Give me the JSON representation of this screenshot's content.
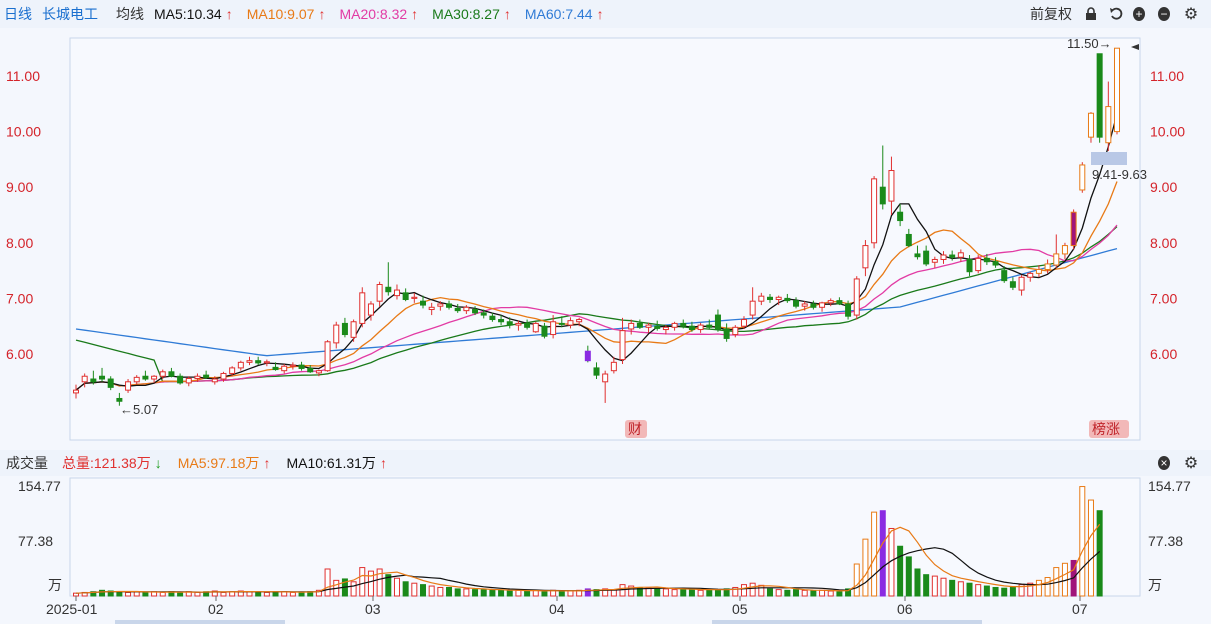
{
  "toolbar": {
    "period": "日线",
    "stock_name": "长城电工",
    "avg_label": "均线",
    "ma5": {
      "label": "MA5:10.34",
      "arrow": "↑",
      "color": "#111111"
    },
    "ma10": {
      "label": "MA10:9.07",
      "arrow": "↑",
      "color": "#e87a16"
    },
    "ma20": {
      "label": "MA20:8.32",
      "arrow": "↑",
      "color": "#e23ba4"
    },
    "ma30": {
      "label": "MA30:8.27",
      "arrow": "↑",
      "color": "#1a7a1a"
    },
    "ma60": {
      "label": "MA60:7.44",
      "arrow": "↑",
      "color": "#2f7bd6"
    },
    "adjust_label": "前复权",
    "icons": [
      "lock-icon",
      "undo-icon",
      "zoom-in-icon",
      "zoom-out-icon",
      "gear-icon"
    ]
  },
  "volume_bar": {
    "title": "成交量",
    "total": {
      "label": "总量:121.38万",
      "arrow": "↓",
      "color": "#e0302f"
    },
    "ma5": {
      "label": "MA5:97.18万",
      "arrow": "↑",
      "color": "#e87a16"
    },
    "ma10": {
      "label": "MA10:61.31万",
      "arrow": "↑",
      "color": "#111111"
    },
    "icons": [
      "close-icon",
      "gear-icon"
    ]
  },
  "chart_data": [
    {
      "type": "candlestick",
      "title": "长城电工 日线",
      "y_ticks": [
        "11.00",
        "10.00",
        "9.00",
        "8.00",
        "7.00",
        "6.00"
      ],
      "ylim": [
        4.6,
        11.9
      ],
      "annotations": {
        "high": "11.50→",
        "low": "←5.07",
        "range": "9.41-9.63"
      },
      "markers": [
        "财",
        "榜涨"
      ],
      "series": [
        {
          "name": "MA5",
          "color": "#111111"
        },
        {
          "name": "MA10",
          "color": "#e87a16"
        },
        {
          "name": "MA20",
          "color": "#e23ba4"
        },
        {
          "name": "MA30",
          "color": "#1a7a1a"
        },
        {
          "name": "MA60",
          "color": "#2f7bd6"
        }
      ],
      "candles": [
        [
          5.3,
          5.45,
          5.2,
          5.35
        ],
        [
          5.5,
          5.65,
          5.4,
          5.6
        ],
        [
          5.55,
          5.7,
          5.45,
          5.5
        ],
        [
          5.6,
          5.75,
          5.5,
          5.55
        ],
        [
          5.55,
          5.6,
          5.35,
          5.4
        ],
        [
          5.2,
          5.3,
          5.07,
          5.15
        ],
        [
          5.35,
          5.55,
          5.3,
          5.5
        ],
        [
          5.5,
          5.62,
          5.45,
          5.58
        ],
        [
          5.6,
          5.7,
          5.52,
          5.55
        ],
        [
          5.55,
          5.62,
          5.48,
          5.6
        ],
        [
          5.6,
          5.72,
          5.55,
          5.68
        ],
        [
          5.68,
          5.75,
          5.58,
          5.6
        ],
        [
          5.6,
          5.65,
          5.45,
          5.48
        ],
        [
          5.48,
          5.6,
          5.42,
          5.56
        ],
        [
          5.56,
          5.65,
          5.5,
          5.6
        ],
        [
          5.62,
          5.7,
          5.55,
          5.58
        ],
        [
          5.5,
          5.6,
          5.45,
          5.55
        ],
        [
          5.55,
          5.68,
          5.5,
          5.65
        ],
        [
          5.65,
          5.78,
          5.6,
          5.75
        ],
        [
          5.75,
          5.88,
          5.7,
          5.85
        ],
        [
          5.85,
          5.95,
          5.8,
          5.88
        ],
        [
          5.88,
          5.95,
          5.8,
          5.84
        ],
        [
          5.84,
          5.9,
          5.78,
          5.86
        ],
        [
          5.76,
          5.85,
          5.7,
          5.72
        ],
        [
          5.7,
          5.82,
          5.65,
          5.78
        ],
        [
          5.78,
          5.85,
          5.72,
          5.8
        ],
        [
          5.8,
          5.86,
          5.7,
          5.74
        ],
        [
          5.74,
          5.8,
          5.66,
          5.68
        ],
        [
          5.66,
          5.72,
          5.6,
          5.7
        ],
        [
          5.7,
          6.25,
          5.68,
          6.22
        ],
        [
          6.2,
          6.58,
          6.1,
          6.52
        ],
        [
          6.55,
          6.65,
          6.3,
          6.35
        ],
        [
          6.3,
          6.62,
          6.22,
          6.58
        ],
        [
          6.55,
          7.2,
          6.48,
          7.1
        ],
        [
          6.7,
          6.95,
          6.6,
          6.9
        ],
        [
          6.95,
          7.3,
          6.85,
          7.25
        ],
        [
          7.2,
          7.65,
          7.05,
          7.12
        ],
        [
          7.05,
          7.25,
          6.98,
          7.15
        ],
        [
          7.1,
          7.18,
          6.95,
          6.98
        ],
        [
          7.0,
          7.1,
          6.92,
          7.02
        ],
        [
          6.95,
          7.05,
          6.82,
          6.88
        ],
        [
          6.8,
          6.92,
          6.7,
          6.84
        ],
        [
          6.86,
          6.95,
          6.78,
          6.9
        ],
        [
          6.9,
          6.96,
          6.8,
          6.84
        ],
        [
          6.82,
          6.9,
          6.74,
          6.78
        ],
        [
          6.78,
          6.88,
          6.72,
          6.84
        ],
        [
          6.8,
          6.86,
          6.7,
          6.74
        ],
        [
          6.74,
          6.8,
          6.64,
          6.7
        ],
        [
          6.68,
          6.74,
          6.58,
          6.62
        ],
        [
          6.62,
          6.7,
          6.52,
          6.58
        ],
        [
          6.58,
          6.66,
          6.46,
          6.52
        ],
        [
          6.52,
          6.6,
          6.42,
          6.55
        ],
        [
          6.55,
          6.62,
          6.44,
          6.48
        ],
        [
          6.4,
          6.58,
          6.38,
          6.55
        ],
        [
          6.5,
          6.56,
          6.28,
          6.32
        ],
        [
          6.35,
          6.7,
          6.28,
          6.58
        ],
        [
          6.55,
          6.68,
          6.48,
          6.54
        ],
        [
          6.52,
          6.66,
          6.46,
          6.6
        ],
        [
          6.58,
          6.65,
          6.5,
          6.62
        ],
        [
          6.05,
          6.15,
          5.85,
          5.88
        ],
        [
          5.75,
          5.85,
          5.55,
          5.62
        ],
        [
          5.5,
          5.7,
          5.12,
          5.64
        ],
        [
          5.7,
          5.95,
          5.65,
          5.85
        ],
        [
          5.9,
          6.65,
          5.82,
          6.42
        ],
        [
          6.45,
          6.62,
          6.35,
          6.55
        ],
        [
          6.55,
          6.62,
          6.45,
          6.48
        ],
        [
          6.48,
          6.56,
          6.38,
          6.52
        ],
        [
          6.5,
          6.6,
          6.42,
          6.46
        ],
        [
          6.44,
          6.52,
          6.35,
          6.48
        ],
        [
          6.48,
          6.58,
          6.42,
          6.55
        ],
        [
          6.55,
          6.62,
          6.46,
          6.5
        ],
        [
          6.5,
          6.58,
          6.4,
          6.44
        ],
        [
          6.44,
          6.56,
          6.38,
          6.52
        ],
        [
          6.52,
          6.62,
          6.45,
          6.48
        ],
        [
          6.7,
          6.8,
          6.4,
          6.45
        ],
        [
          6.45,
          6.55,
          6.22,
          6.28
        ],
        [
          6.35,
          6.52,
          6.3,
          6.48
        ],
        [
          6.5,
          6.68,
          6.45,
          6.62
        ],
        [
          6.7,
          7.2,
          6.62,
          6.95
        ],
        [
          6.95,
          7.1,
          6.88,
          7.04
        ],
        [
          7.02,
          7.08,
          6.92,
          6.98
        ],
        [
          6.98,
          7.05,
          6.88,
          7.02
        ],
        [
          7.0,
          7.08,
          6.92,
          6.96
        ],
        [
          6.96,
          7.02,
          6.82,
          6.86
        ],
        [
          6.86,
          6.95,
          6.78,
          6.9
        ],
        [
          6.9,
          6.96,
          6.8,
          6.84
        ],
        [
          6.84,
          6.94,
          6.76,
          6.92
        ],
        [
          6.92,
          7.0,
          6.86,
          6.96
        ],
        [
          6.96,
          7.02,
          6.88,
          6.9
        ],
        [
          6.9,
          6.96,
          6.62,
          6.68
        ],
        [
          6.7,
          7.4,
          6.62,
          7.35
        ],
        [
          7.55,
          8.05,
          7.4,
          7.95
        ],
        [
          8.0,
          9.2,
          7.9,
          9.15
        ],
        [
          9.0,
          9.75,
          8.6,
          8.7
        ],
        [
          8.75,
          9.55,
          8.5,
          9.3
        ],
        [
          8.55,
          8.7,
          8.3,
          8.4
        ],
        [
          8.15,
          8.25,
          7.92,
          7.95
        ],
        [
          7.8,
          7.95,
          7.7,
          7.75
        ],
        [
          7.85,
          7.95,
          7.58,
          7.62
        ],
        [
          7.65,
          7.75,
          7.55,
          7.7
        ],
        [
          7.7,
          7.85,
          7.62,
          7.78
        ],
        [
          7.78,
          7.86,
          7.68,
          7.74
        ],
        [
          7.74,
          7.88,
          7.66,
          7.82
        ],
        [
          7.7,
          7.78,
          7.4,
          7.48
        ],
        [
          7.5,
          7.78,
          7.45,
          7.72
        ],
        [
          7.72,
          7.8,
          7.6,
          7.66
        ],
        [
          7.66,
          7.74,
          7.55,
          7.6
        ],
        [
          7.5,
          7.58,
          7.28,
          7.32
        ],
        [
          7.3,
          7.38,
          7.15,
          7.2
        ],
        [
          7.15,
          7.42,
          7.05,
          7.38
        ],
        [
          7.38,
          7.48,
          7.3,
          7.45
        ],
        [
          7.45,
          7.6,
          7.38,
          7.52
        ],
        [
          7.52,
          7.7,
          7.45,
          7.62
        ],
        [
          7.6,
          8.15,
          7.55,
          7.8
        ],
        [
          7.8,
          8.0,
          7.7,
          7.95
        ],
        [
          7.95,
          8.6,
          7.88,
          8.55
        ],
        [
          8.95,
          9.45,
          8.9,
          9.4
        ],
        [
          9.9,
          10.35,
          9.8,
          10.33
        ],
        [
          11.4,
          11.4,
          9.8,
          9.9
        ],
        [
          9.8,
          10.9,
          9.65,
          10.45
        ],
        [
          10.0,
          11.5,
          9.95,
          11.5
        ]
      ],
      "ma": {
        "MA5": [
          5.5,
          5.55,
          5.5,
          5.48,
          5.45,
          5.48,
          5.52,
          5.55,
          5.58,
          5.6,
          5.6,
          5.58,
          5.58,
          5.6,
          5.62,
          5.65,
          5.7,
          5.75,
          5.8,
          5.82,
          5.82,
          5.8,
          5.78,
          5.76,
          5.75,
          5.75,
          5.74,
          5.8,
          6.0,
          6.25,
          6.45,
          6.65,
          6.85,
          6.98,
          7.05,
          7.1,
          7.08,
          7.02,
          6.96,
          6.9,
          6.86,
          6.84,
          6.84,
          6.82,
          6.8,
          6.78,
          6.74,
          6.7,
          6.64,
          6.6,
          6.58,
          6.55,
          6.52,
          6.5,
          6.48,
          6.5,
          6.55,
          6.58,
          6.56,
          6.3,
          6.05,
          5.88,
          5.95,
          6.15,
          6.32,
          6.42,
          6.48,
          6.5,
          6.5,
          6.5,
          6.49,
          6.48,
          6.47,
          6.46,
          6.44,
          6.46,
          6.55,
          6.7,
          6.85,
          6.94,
          6.98,
          6.97,
          6.94,
          6.92,
          6.91,
          6.9,
          6.92,
          6.9,
          6.88,
          7.02,
          7.35,
          7.85,
          8.35,
          8.65,
          8.62,
          8.4,
          8.12,
          7.9,
          7.76,
          7.72,
          7.74,
          7.72,
          7.68,
          7.64,
          7.58,
          7.48,
          7.4,
          7.38,
          7.4,
          7.46,
          7.55,
          7.66,
          7.82,
          8.2,
          8.75,
          9.2,
          9.6,
          9.95,
          10.34
        ],
        "MA10": [
          5.55,
          5.55,
          5.54,
          5.52,
          5.5,
          5.5,
          5.5,
          5.52,
          5.54,
          5.56,
          5.58,
          5.6,
          5.62,
          5.64,
          5.66,
          5.68,
          5.7,
          5.72,
          5.74,
          5.75,
          5.75,
          5.74,
          5.74,
          5.76,
          5.82,
          5.92,
          6.05,
          6.2,
          6.38,
          6.55,
          6.7,
          6.82,
          6.92,
          6.98,
          7.0,
          6.98,
          6.95,
          6.92,
          6.88,
          6.85,
          6.82,
          6.8,
          6.77,
          6.74,
          6.7,
          6.67,
          6.64,
          6.62,
          6.6,
          6.58,
          6.56,
          6.52,
          6.46,
          6.38,
          6.3,
          6.25,
          6.24,
          6.26,
          6.3,
          6.34,
          6.38,
          6.42,
          6.44,
          6.46,
          6.47,
          6.48,
          6.5,
          6.54,
          6.6,
          6.68,
          6.74,
          6.8,
          6.85,
          6.88,
          6.9,
          6.91,
          6.9,
          6.92,
          7.0,
          7.18,
          7.42,
          7.7,
          7.98,
          8.1,
          8.18,
          8.2,
          8.15,
          8.06,
          7.96,
          7.88,
          7.82,
          7.76,
          7.7,
          7.66,
          7.62,
          7.6,
          7.58,
          7.56,
          7.56,
          7.6,
          7.68,
          7.78,
          7.9,
          8.05,
          8.25,
          8.5,
          8.8,
          9.07
        ],
        "MA20": [
          6.15,
          6.05,
          5.95,
          5.88,
          5.82,
          5.76,
          5.7,
          5.66,
          5.62,
          5.6,
          5.58,
          5.58,
          5.6,
          5.64,
          5.7,
          5.78,
          5.88,
          5.98,
          6.1,
          6.22,
          6.35,
          6.48,
          6.6,
          6.7,
          6.78,
          6.83,
          6.86,
          6.88,
          6.88,
          6.86,
          6.84,
          6.82,
          6.78,
          6.74,
          6.7,
          6.66,
          6.62,
          6.58,
          6.56,
          6.54,
          6.53,
          6.52,
          6.52,
          6.52,
          6.54,
          6.56,
          6.58,
          6.62,
          6.66,
          6.7,
          6.74,
          6.78,
          6.82,
          6.86,
          6.9,
          6.96,
          7.04,
          7.14,
          7.26,
          7.4,
          7.54,
          7.66,
          7.76,
          7.84,
          7.88,
          7.9,
          7.88,
          7.86,
          7.84,
          7.82,
          7.8,
          7.8,
          7.82,
          7.86,
          7.94,
          8.05,
          8.18,
          8.32
        ]
      }
    },
    {
      "type": "bar",
      "title": "成交量",
      "y_ticks": [
        "154.77",
        "77.38"
      ],
      "unit": "万",
      "ylim": [
        0,
        154.77
      ],
      "x_ticks": [
        "2025-01",
        "02",
        "03",
        "04",
        "05",
        "06",
        "07"
      ],
      "values": [
        4,
        5,
        6,
        8,
        7,
        6,
        5,
        6,
        5,
        6,
        5,
        6,
        5,
        6,
        5,
        6,
        7,
        5,
        6,
        7,
        6,
        6,
        5,
        6,
        6,
        5,
        5,
        6,
        8,
        38,
        22,
        24,
        20,
        40,
        35,
        38,
        30,
        25,
        20,
        18,
        16,
        14,
        12,
        12,
        10,
        10,
        9,
        9,
        8,
        8,
        7,
        8,
        7,
        8,
        6,
        8,
        7,
        7,
        8,
        10,
        9,
        10,
        9,
        16,
        14,
        12,
        11,
        10,
        10,
        9,
        10,
        9,
        8,
        9,
        8,
        10,
        12,
        16,
        18,
        15,
        10,
        9,
        8,
        9,
        8,
        7,
        8,
        7,
        6,
        10,
        45,
        80,
        118,
        120,
        95,
        70,
        55,
        38,
        30,
        28,
        25,
        22,
        20,
        18,
        16,
        14,
        12,
        11,
        13,
        16,
        18,
        22,
        26,
        40,
        46,
        50,
        154,
        135,
        120
      ]
    }
  ]
}
